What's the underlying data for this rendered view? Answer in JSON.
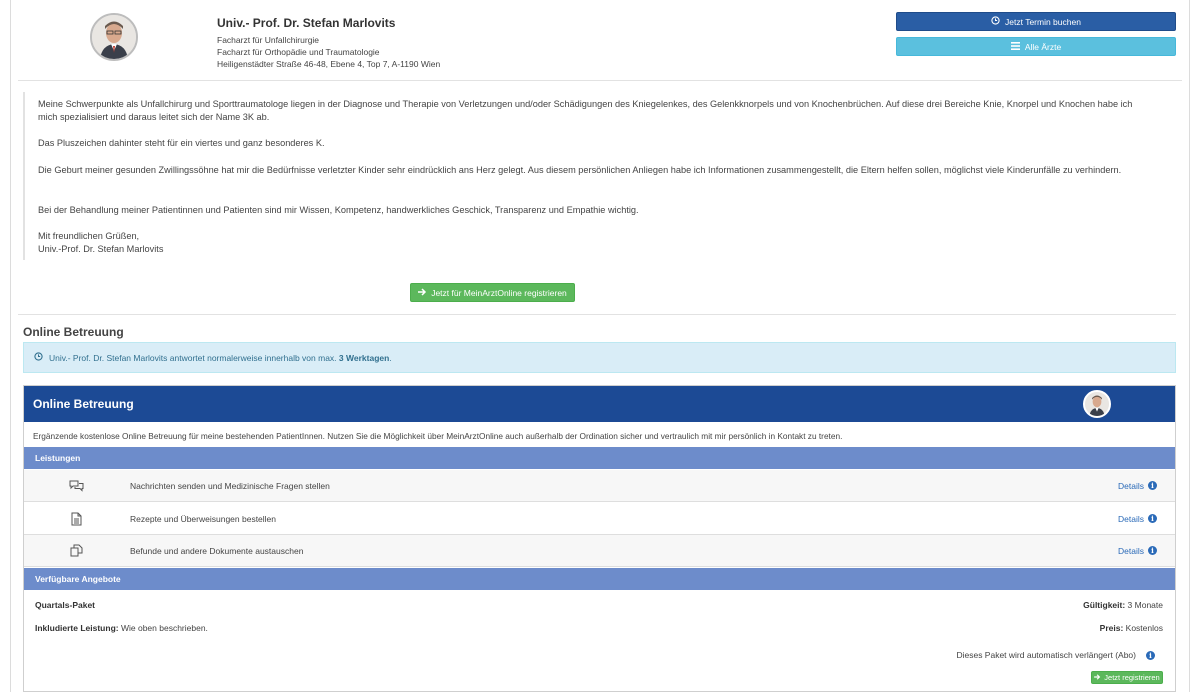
{
  "doctor": {
    "name": "Univ.- Prof. Dr. Stefan Marlovits",
    "specialty1": "Facharzt für Unfallchirurgie",
    "specialty2": "Facharzt für Orthopädie und Traumatologie",
    "address": "Heiligenstädter Straße 46-48, Ebene 4, Top 7, A-1190 Wien"
  },
  "header_buttons": {
    "termin_label": "Jetzt Termin buchen",
    "aerzte_label": "Alle Ärzte"
  },
  "bio": {
    "p1": "Meine Schwerpunkte als Unfallchirurg und Sporttraumatologe liegen in der Diagnose und Therapie von Verletzungen und/oder Schädigungen des Kniegelenkes, des Gelenkknorpels und von Knochenbrüchen. Auf diese drei Bereiche Knie, Knorpel und Knochen habe ich mich spezialisiert und daraus leitet sich der Name 3K ab.",
    "p2": "Das Pluszeichen dahinter steht für ein viertes und ganz besonderes K.",
    "p3": "Die Geburt meiner gesunden Zwillingssöhne hat mir die Bedürfnisse verletzter Kinder sehr eindrücklich ans Herz gelegt. Aus diesem persönlichen Anliegen habe ich Informationen zusammengestellt, die Eltern helfen sollen, möglichst viele Kinderunfälle zu verhindern.",
    "p4": "Bei der Behandlung meiner Patientinnen und Patienten sind mir Wissen, Kompetenz, handwerkliches Geschick, Transparenz und Empathie wichtig.",
    "greeting": "Mit freundlichen Grüßen,",
    "signature": "Univ.-Prof. Dr. Stefan Marlovits"
  },
  "register_button": "Jetzt für MeinArztOnline registrieren",
  "online_section_title": "Online Betreuung",
  "info_box": {
    "text": "Univ.- Prof. Dr. Stefan Marlovits antwortet normalerweise innerhalb von max.",
    "highlight": "3 Werktagen",
    "suffix": "."
  },
  "panel": {
    "title": "Online Betreuung",
    "description": "Ergänzende kostenlose Online Betreuung für meine bestehenden PatientInnen. Nutzen Sie die Möglichkeit über MeinArztOnline auch außerhalb der Ordination sicher und vertraulich mit mir persönlich in Kontakt zu treten.",
    "services_header": "Leistungen",
    "services": [
      {
        "icon": "chat-bubbles-icon",
        "label": "Nachrichten senden und Medizinische Fragen stellen",
        "details": "Details"
      },
      {
        "icon": "document-icon",
        "label": "Rezepte und Überweisungen bestellen",
        "details": "Details"
      },
      {
        "icon": "copy-files-icon",
        "label": "Befunde und andere Dokumente austauschen",
        "details": "Details"
      }
    ],
    "offers_header": "Verfügbare Angebote",
    "offer": {
      "name": "Quartals-Paket",
      "validity_label": "Gültigkeit:",
      "validity_value": "3 Monate",
      "included_label": "Inkludierte Leistung:",
      "included_value": "Wie oben beschrieben.",
      "price_label": "Preis:",
      "price_value": "Kostenlos",
      "renew_note": "Dieses Paket wird automatisch verlängert (Abo)",
      "register_label": "Jetzt registrieren"
    }
  }
}
